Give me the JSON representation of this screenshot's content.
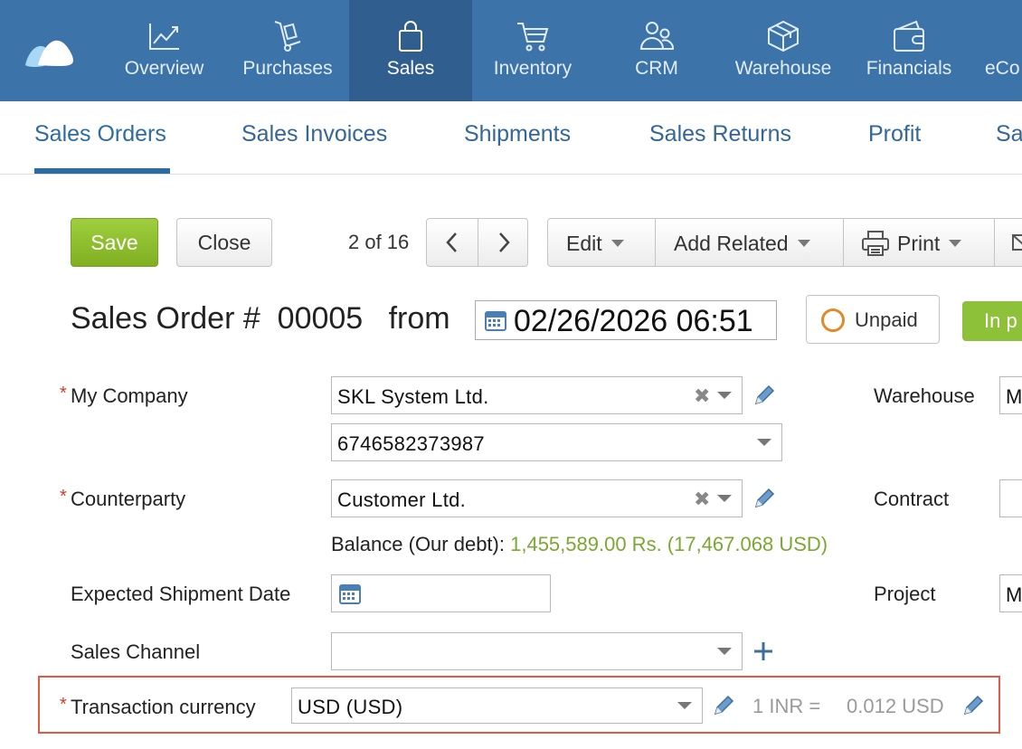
{
  "topnav": {
    "items": [
      {
        "label": "Overview",
        "icon": "chart-line-icon"
      },
      {
        "label": "Purchases",
        "icon": "hand-truck-icon"
      },
      {
        "label": "Sales",
        "icon": "shopping-bag-icon",
        "active": true
      },
      {
        "label": "Inventory",
        "icon": "cart-icon"
      },
      {
        "label": "CRM",
        "icon": "people-icon"
      },
      {
        "label": "Warehouse",
        "icon": "box-icon"
      },
      {
        "label": "Financials",
        "icon": "wallet-icon"
      },
      {
        "label": "eCo",
        "icon": ""
      }
    ]
  },
  "subnav": {
    "tabs": [
      {
        "label": "Sales Orders",
        "active": true
      },
      {
        "label": "Sales Invoices"
      },
      {
        "label": "Shipments"
      },
      {
        "label": "Sales Returns"
      },
      {
        "label": "Profit"
      },
      {
        "label": "Sa"
      }
    ]
  },
  "toolbar": {
    "save": "Save",
    "close": "Close",
    "pager": "2 of 16",
    "edit": "Edit",
    "add_related": "Add Related",
    "print": "Print"
  },
  "header": {
    "title_prefix": "Sales Order #",
    "number": "00005",
    "from": "from",
    "date": "02/26/2026 06:51",
    "status_unpaid": "Unpaid",
    "status_progress": "In p"
  },
  "form": {
    "my_company_label": "My Company",
    "my_company_value": "SKL System Ltd.",
    "account_value": "6746582373987",
    "counterparty_label": "Counterparty",
    "counterparty_value": "Customer Ltd.",
    "balance_label": "Balance (Our debt):",
    "balance_value": "1,455,589.00 Rs. (17,467.068 USD)",
    "expected_shipment_label": "Expected Shipment Date",
    "sales_channel_label": "Sales Channel",
    "transaction_currency_label": "Transaction currency",
    "transaction_currency_value": "USD (USD)",
    "rate_left": "1 INR  =",
    "rate_right": "0.012 USD",
    "warehouse_label": "Warehouse",
    "warehouse_value": "M",
    "contract_label": "Contract",
    "project_label": "Project",
    "project_value": "M"
  },
  "colors": {
    "nav_bg": "#3c73a8",
    "nav_active": "#305f8f",
    "save_green": "#8ec13a",
    "link_blue": "#2d6ca2",
    "required_red": "#d43a2a",
    "highlight_red": "#e05a46",
    "unpaid_orange": "#e08b2a"
  }
}
